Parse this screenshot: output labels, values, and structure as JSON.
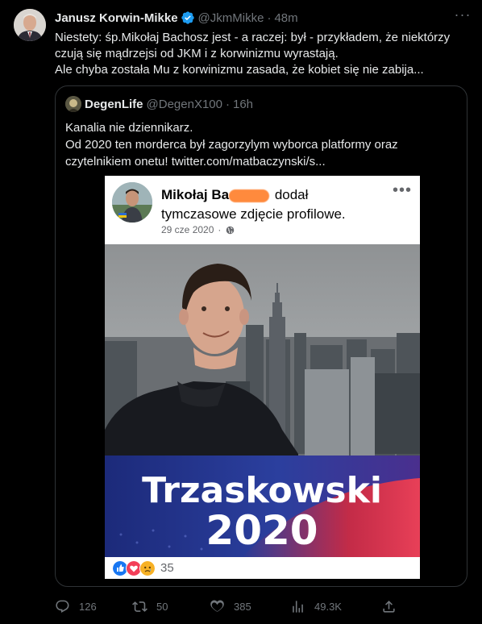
{
  "tweet": {
    "author_name": "Janusz Korwin-Mikke",
    "handle": "@JkmMikke",
    "separator": "·",
    "time": "48m",
    "more": "···",
    "lines": [
      "Niestety: śp.Mikołaj Bachosz jest - a raczej: był - przykładem, że niektórzy",
      "czują się mądrzejsi od JKM i z korwinizmu wyrastają.",
      "Ale chyba została Mu z korwinizmu zasada, że kobiet się nie zabija..."
    ]
  },
  "quote": {
    "author_name": "DegenLife",
    "handle": "@DegenX100",
    "separator": "·",
    "time": "16h",
    "lines": [
      "Kanalia nie dziennikarz.",
      "Od 2020 ten morderca był zagorzylym wyborca platformy oraz",
      "czytelnikiem onetu!  twitter.com/matbaczynski/s..."
    ],
    "image": {
      "fb_name": "Mikołaj Ba",
      "fb_action": " dodał",
      "fb_line2": "tymczasowe zdjęcie profilowe.",
      "fb_date": "29 cze 2020",
      "fb_sep": "·",
      "fb_more": "•••",
      "banner_line1": "Trzaskowski",
      "banner_line2": "2020",
      "reaction_count": "35"
    }
  },
  "actions": {
    "replies": "126",
    "retweets": "50",
    "likes": "385",
    "views": "49.3K"
  },
  "colors": {
    "background": "#000000",
    "text": "#e7e9ea",
    "secondary": "#71767b",
    "border": "#2f3336",
    "verified": "#1d9bf0",
    "redaction": "#ff8a3d"
  }
}
